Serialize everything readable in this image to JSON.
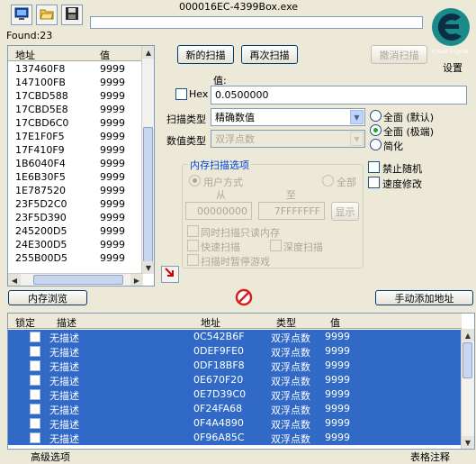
{
  "window": {
    "title": "000016EC-4399Box.exe"
  },
  "toolbar": {
    "process_icon": "computer-icon",
    "open_icon": "folder-open-icon",
    "save_icon": "floppy-disk-icon"
  },
  "logo": {
    "caption": "Cheat Engine",
    "settings_label": "设置"
  },
  "found": "Found:23",
  "results": {
    "headers": {
      "address": "地址",
      "value": "值"
    },
    "rows": [
      {
        "address": "137460F8",
        "value": "9999"
      },
      {
        "address": "147100FB",
        "value": "9999"
      },
      {
        "address": "17CBD588",
        "value": "9999"
      },
      {
        "address": "17CBD5E8",
        "value": "9999"
      },
      {
        "address": "17CBD6C0",
        "value": "9999"
      },
      {
        "address": "17E1F0F5",
        "value": "9999"
      },
      {
        "address": "17F410F9",
        "value": "9999"
      },
      {
        "address": "1B6040F4",
        "value": "9999"
      },
      {
        "address": "1E6B30F5",
        "value": "9999"
      },
      {
        "address": "1E787520",
        "value": "9999"
      },
      {
        "address": "23F5D2C0",
        "value": "9999"
      },
      {
        "address": "23F5D390",
        "value": "9999"
      },
      {
        "address": "245200D5",
        "value": "9999"
      },
      {
        "address": "24E300D5",
        "value": "9999"
      },
      {
        "address": "255B00D5",
        "value": "9999"
      }
    ]
  },
  "scan": {
    "new_scan": "新的扫描",
    "next_scan": "再次扫描",
    "undo_scan": "撤消扫描",
    "value_label": "值:",
    "hex_label": "Hex",
    "value": "0.0500000",
    "scan_type_label": "扫描类型",
    "scan_type": "精确数值",
    "value_type_label": "数值类型",
    "value_type": "双浮点数",
    "round_default": "全面 (默认)",
    "round_extreme": "全面 (极端)",
    "simplified": "简化",
    "disable_random": "禁止随机",
    "speed_modify": "速度修改"
  },
  "memory_options": {
    "title": "内存扫描选项",
    "user_mode": "用户方式",
    "all": "全部",
    "from_label": "从",
    "to_label": "至",
    "from": "00000000",
    "to": "7FFFFFFF",
    "show": "显示",
    "readonly_too": "同时扫描只读内存",
    "fast_scan": "快速扫描",
    "deep_scan": "深度扫描",
    "pause_game": "扫描时暂停游戏"
  },
  "actions": {
    "memory_view": "内存浏览",
    "add_manual": "手动添加地址",
    "arrow_icon": "arrow-down-right-icon",
    "stop_icon": "no-entry-icon"
  },
  "cheat_table": {
    "headers": {
      "lock": "锁定",
      "description": "描述",
      "address": "地址",
      "type": "类型",
      "value": "值"
    },
    "rows": [
      {
        "description": "无描述",
        "address": "0C542B6F",
        "type": "双浮点数",
        "value": "9999"
      },
      {
        "description": "无描述",
        "address": "0DEF9FE0",
        "type": "双浮点数",
        "value": "9999"
      },
      {
        "description": "无描述",
        "address": "0DF18BF8",
        "type": "双浮点数",
        "value": "9999"
      },
      {
        "description": "无描述",
        "address": "0E670F20",
        "type": "双浮点数",
        "value": "9999"
      },
      {
        "description": "无描述",
        "address": "0E7D39C0",
        "type": "双浮点数",
        "value": "9999"
      },
      {
        "description": "无描述",
        "address": "0F24FA68",
        "type": "双浮点数",
        "value": "9999"
      },
      {
        "description": "无描述",
        "address": "0F4A4890",
        "type": "双浮点数",
        "value": "9999"
      },
      {
        "description": "无描述",
        "address": "0F96A85C",
        "type": "双浮点数",
        "value": "9999"
      }
    ]
  },
  "footer": {
    "advanced": "高级选项",
    "table_extras": "表格注释"
  },
  "colors": {
    "selection": "#3169c6",
    "logo": "#1a8a8a",
    "stop": "#d42020"
  }
}
